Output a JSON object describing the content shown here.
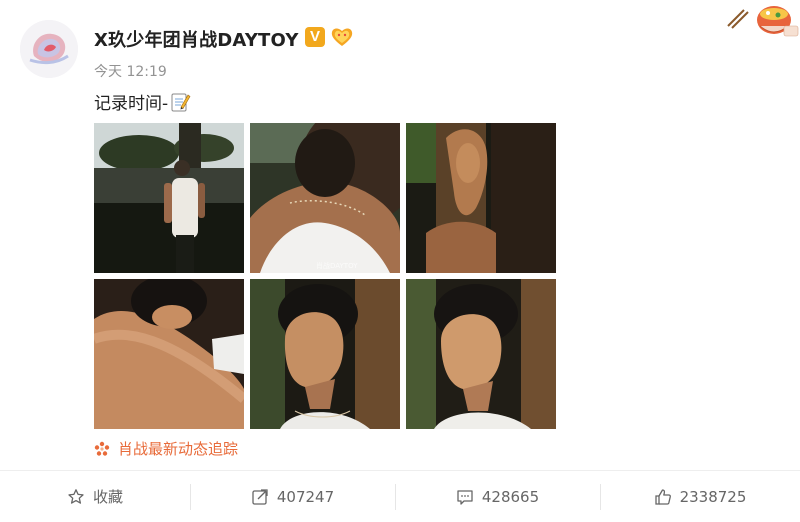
{
  "post": {
    "username": "X玖少年团肖战DAYTOY",
    "verified_badge": "V",
    "time": "今天 12:19",
    "text": "记录时间-",
    "text_emoji": "memo-icon",
    "tracker_label": "肖战最新动态追踪"
  },
  "photos": [
    {
      "alt": "man-by-tree-photo"
    },
    {
      "alt": "neck-closeup-photo"
    },
    {
      "alt": "hand-on-tree-photo"
    },
    {
      "alt": "arm-raised-portrait-photo"
    },
    {
      "alt": "profile-sunlight-photo-1"
    },
    {
      "alt": "profile-sunlight-photo-2"
    }
  ],
  "actions": {
    "favorite_label": "收藏",
    "repost_count": "407247",
    "comment_count": "428665",
    "like_count": "2338725"
  },
  "colors": {
    "accent_orange": "#e86b3a",
    "verified_gold": "#f2a81d",
    "meta_gray": "#939393"
  }
}
